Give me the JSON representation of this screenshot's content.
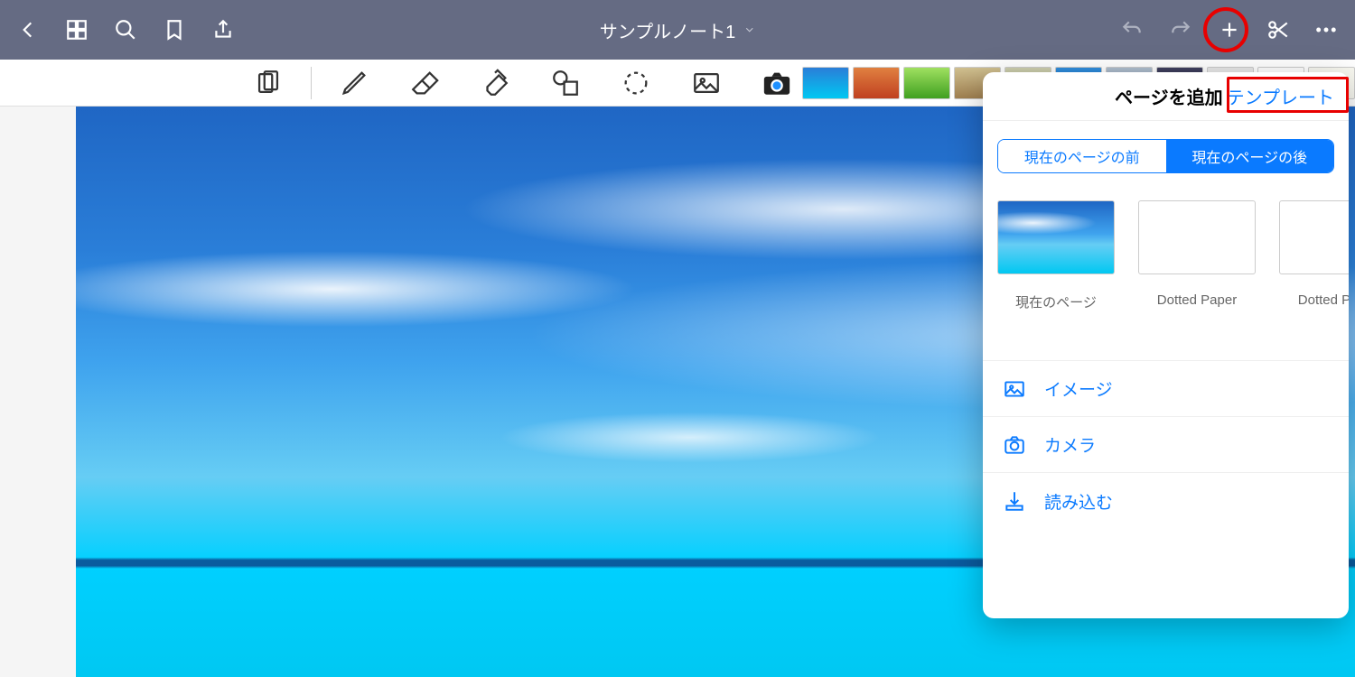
{
  "title": "サンプルノート1",
  "nav_icons": {
    "back": "back-icon",
    "grid": "grid-icon",
    "search": "search-icon",
    "bookmark": "bookmark-icon",
    "share": "share-icon",
    "undo": "undo-icon",
    "redo": "redo-icon",
    "add": "plus-icon",
    "scissors": "scissors-icon",
    "more": "more-icon"
  },
  "tools": [
    "page-rotate",
    "pen",
    "eraser",
    "highlighter",
    "shapes",
    "lasso",
    "image",
    "camera",
    "text"
  ],
  "thumbs": [
    {
      "name": "sky",
      "bg": "linear-gradient(#2a7ed8,#00c8f2)"
    },
    {
      "name": "autumn",
      "bg": "linear-gradient(#e08040,#c04020)"
    },
    {
      "name": "green",
      "bg": "linear-gradient(#9fe060,#40a020)"
    },
    {
      "name": "old",
      "bg": "linear-gradient(#d0c090,#a08050)"
    },
    {
      "name": "map",
      "bg": "linear-gradient(#d0d0b0,#90a070)"
    },
    {
      "name": "blue",
      "bg": "linear-gradient(#3090e0,#1050a0)"
    },
    {
      "name": "abstract",
      "bg": "linear-gradient(#b0c0d0,#708090)"
    },
    {
      "name": "dark",
      "bg": "linear-gradient(#404060,#202030)"
    },
    {
      "name": "grey",
      "bg": "#e8e8e8"
    },
    {
      "name": "white",
      "bg": "#ffffff"
    },
    {
      "name": "lines",
      "bg": "#f8f8f0"
    }
  ],
  "popup": {
    "title": "ページを追加",
    "template_link": "テンプレート",
    "seg_before": "現在のページの前",
    "seg_after": "現在のページの後",
    "cards": [
      {
        "label": "現在のページ",
        "style": "sky"
      },
      {
        "label": "Dotted Paper",
        "style": "blank"
      },
      {
        "label": "Dotted Paper",
        "style": "blank"
      }
    ],
    "opts": [
      {
        "icon": "image",
        "label": "イメージ"
      },
      {
        "icon": "camera",
        "label": "カメラ"
      },
      {
        "icon": "import",
        "label": "読み込む"
      }
    ]
  },
  "highlights": {
    "plus_circle": true,
    "template_box": true
  }
}
